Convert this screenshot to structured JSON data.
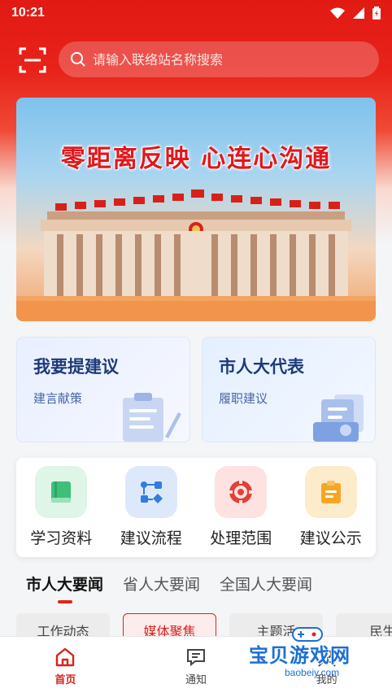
{
  "status": {
    "time": "10:21"
  },
  "header": {
    "search_placeholder": "请输入联络站名称搜索"
  },
  "banner": {
    "title": "零距离反映  心连心沟通"
  },
  "cards": [
    {
      "title": "我要提建议",
      "subtitle": "建言献策"
    },
    {
      "title": "市人大代表",
      "subtitle": "履职建议"
    }
  ],
  "quick_links": [
    {
      "label": "学习资料",
      "icon": "book-icon",
      "color": "#3fbf7a"
    },
    {
      "label": "建议流程",
      "icon": "flow-icon",
      "color": "#2f7de0"
    },
    {
      "label": "处理范围",
      "icon": "target-icon",
      "color": "#e2403a"
    },
    {
      "label": "建议公示",
      "icon": "clipboard-icon",
      "color": "#f5a623"
    }
  ],
  "news_tabs": [
    {
      "label": "市人大要闻",
      "active": true
    },
    {
      "label": "省人大要闻",
      "active": false
    },
    {
      "label": "全国人大要闻",
      "active": false
    }
  ],
  "chips": [
    {
      "label": "工作动态",
      "active": false
    },
    {
      "label": "媒体聚焦",
      "active": true
    },
    {
      "label": "主题活",
      "active": false
    },
    {
      "label": "民生",
      "active": false
    }
  ],
  "bottom_nav": [
    {
      "label": "首页",
      "icon": "home-icon",
      "active": true
    },
    {
      "label": "通知",
      "icon": "message-icon",
      "active": false
    },
    {
      "label": "我的",
      "icon": "user-icon",
      "active": false
    }
  ],
  "watermark": {
    "name": "宝贝游戏网",
    "url": "baobeiy.com"
  },
  "colors": {
    "brand_red": "#e0241b",
    "nav_blue": "#1d3a7a"
  }
}
